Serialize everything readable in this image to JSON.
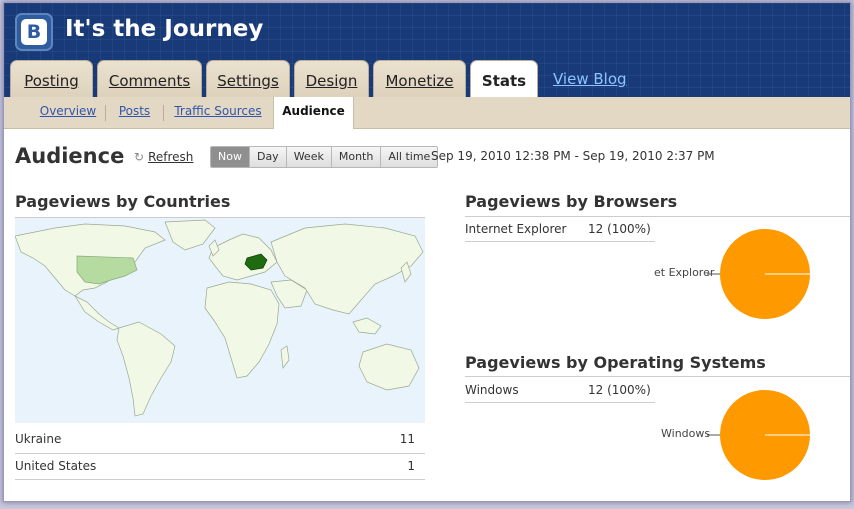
{
  "header": {
    "logo_glyph": "B",
    "blog_title": "It's the Journey",
    "view_blog": "View Blog"
  },
  "tabs": [
    {
      "label": "Posting"
    },
    {
      "label": "Comments"
    },
    {
      "label": "Settings"
    },
    {
      "label": "Design"
    },
    {
      "label": "Monetize"
    },
    {
      "label": "Stats",
      "active": true
    }
  ],
  "subnav": [
    {
      "label": "Overview"
    },
    {
      "label": "Posts"
    },
    {
      "label": "Traffic Sources"
    },
    {
      "label": "Audience",
      "active": true
    }
  ],
  "page": {
    "title": "Audience",
    "refresh": "Refresh",
    "date_range": "Sep 19, 2010 12:38 PM - Sep 19, 2010 2:37 PM"
  },
  "range_buttons": [
    {
      "label": "Now",
      "active": true
    },
    {
      "label": "Day"
    },
    {
      "label": "Week"
    },
    {
      "label": "Month"
    },
    {
      "label": "All time"
    }
  ],
  "countries": {
    "title": "Pageviews by Countries",
    "rows": [
      {
        "name": "Ukraine",
        "count": "11"
      },
      {
        "name": "United States",
        "count": "1"
      }
    ],
    "highlight_colors": {
      "high": "#1e6b10",
      "low": "#b5dba0",
      "land": "#f2f8e6",
      "water": "#e8f3fc"
    }
  },
  "browsers": {
    "title": "Pageviews by Browsers",
    "rows": [
      {
        "name": "Internet Explorer",
        "value": "12 (100%)"
      }
    ],
    "pie_label": "et Explorer",
    "pie_color": "#ff9900"
  },
  "os": {
    "title": "Pageviews by Operating Systems",
    "rows": [
      {
        "name": "Windows",
        "value": "12 (100%)"
      }
    ],
    "pie_label": "Windows",
    "pie_color": "#ff9900"
  }
}
